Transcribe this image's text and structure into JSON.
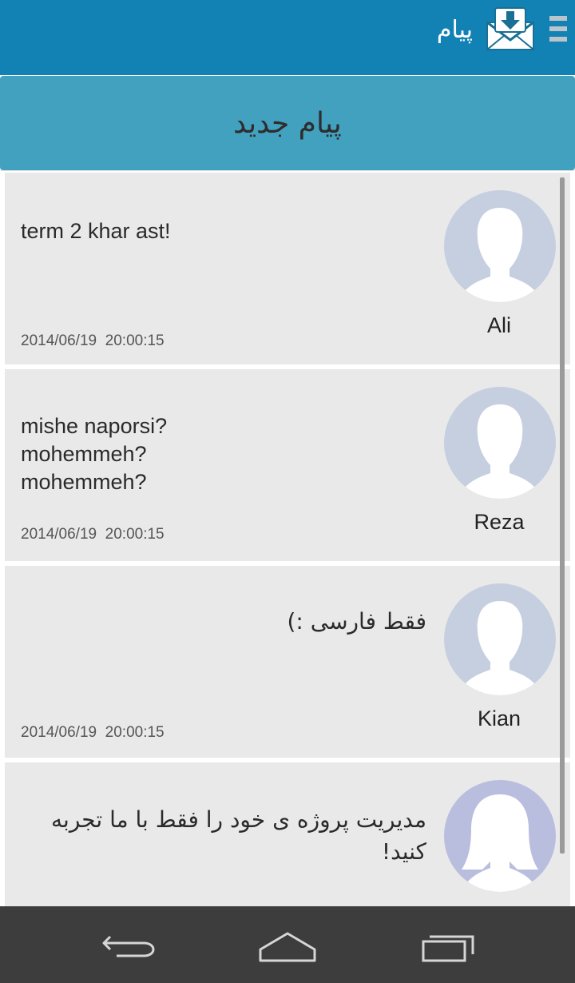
{
  "appbar": {
    "title": "پیام",
    "menu_icon": "hamburger-menu-icon",
    "logo_icon": "mail-download-icon",
    "background": "#1282b4"
  },
  "new_message_button": {
    "label": "پیام جدید",
    "color": "#42a1bf"
  },
  "messages": [
    {
      "sender": "Ali",
      "text": "term 2 khar ast!",
      "date": "2014/06/19",
      "time": "20:00:15",
      "avatar": "male-avatar-icon"
    },
    {
      "sender": "Reza",
      "text": "mishe naporsi?\nmohemmeh?\nmohemmeh?",
      "date": "2014/06/19",
      "time": "20:00:15",
      "avatar": "male-avatar-icon"
    },
    {
      "sender": "Kian",
      "text": "فقط فارسی :)",
      "date": "2014/06/19",
      "time": "20:00:15",
      "avatar": "male-avatar-icon"
    },
    {
      "sender": "",
      "text": "مدیریت پروژه ی خود را فقط با ما تجربه کنید!",
      "date": "",
      "time": "",
      "avatar": "female-avatar-icon"
    }
  ],
  "navbar": {
    "back_icon": "back-icon",
    "home_icon": "home-icon",
    "recents_icon": "recent-apps-icon"
  }
}
